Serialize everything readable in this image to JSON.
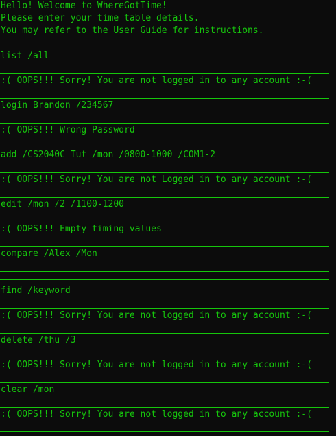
{
  "terminal": {
    "welcome": [
      "Hello! Welcome to WhereGotTime!",
      "Please enter your time table details.",
      "You may refer to the User Guide for instructions."
    ],
    "entries": [
      {
        "text": "list /all"
      },
      {
        "text": ":( OOPS!!! Sorry! You are not logged in to any account :-("
      },
      {
        "text": "login Brandon /234567"
      },
      {
        "text": ":( OOPS!!! Wrong Password"
      },
      {
        "text": "add /CS2040C Tut /mon /0800-1000 /COM1-2"
      },
      {
        "text": ":( OOPS!!! Sorry! You are not Logged in to any account :-("
      },
      {
        "text": "edit /mon /2 /1100-1200"
      },
      {
        "text": ":( OOPS!!! Empty timing values"
      },
      {
        "text": "compare /Alex /Mon"
      },
      {
        "text": ""
      },
      {
        "text": "find /keyword"
      },
      {
        "text": ":( OOPS!!! Sorry! You are not logged in to any account :-("
      },
      {
        "text": "delete /thu /3"
      },
      {
        "text": ":( OOPS!!! Sorry! You are not logged in to any account :-("
      },
      {
        "text": "clear /mon"
      },
      {
        "text": ":( OOPS!!! Sorry! You are not logged in to any account :-("
      }
    ],
    "colors": {
      "background": "#0c0c0c",
      "text": "#16c60c"
    }
  }
}
